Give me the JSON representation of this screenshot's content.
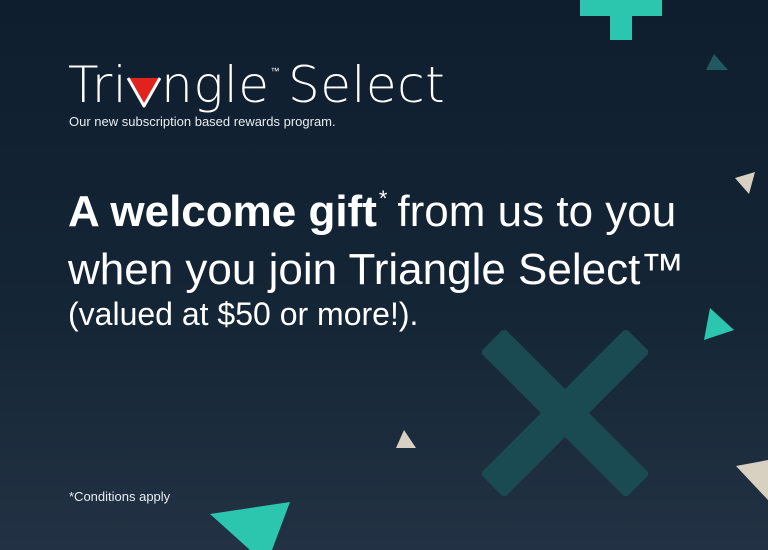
{
  "brand": {
    "logo_text_before": "Tri",
    "logo_text_after": "ngle",
    "logo_tm": "™",
    "logo_suffix": "Select",
    "logo_icon": "triangle-logo-icon"
  },
  "tagline": "Our new subscription based rewards program.",
  "headline": {
    "bold": "A welcome gift",
    "asterisk": "*",
    "rest": "from us to you when you join Triangle Select™"
  },
  "valued_text": "(valued at $50 or more!).",
  "conditions": "*Conditions apply",
  "colors": {
    "background": "#0f1e2e",
    "accent_teal": "#2cc6ae",
    "dark_teal": "#1a4a52",
    "beige": "#d8d0c0",
    "brand_red": "#e0231c"
  },
  "decorations": [
    "plus-shape",
    "x-shape",
    "triangle-shape"
  ]
}
